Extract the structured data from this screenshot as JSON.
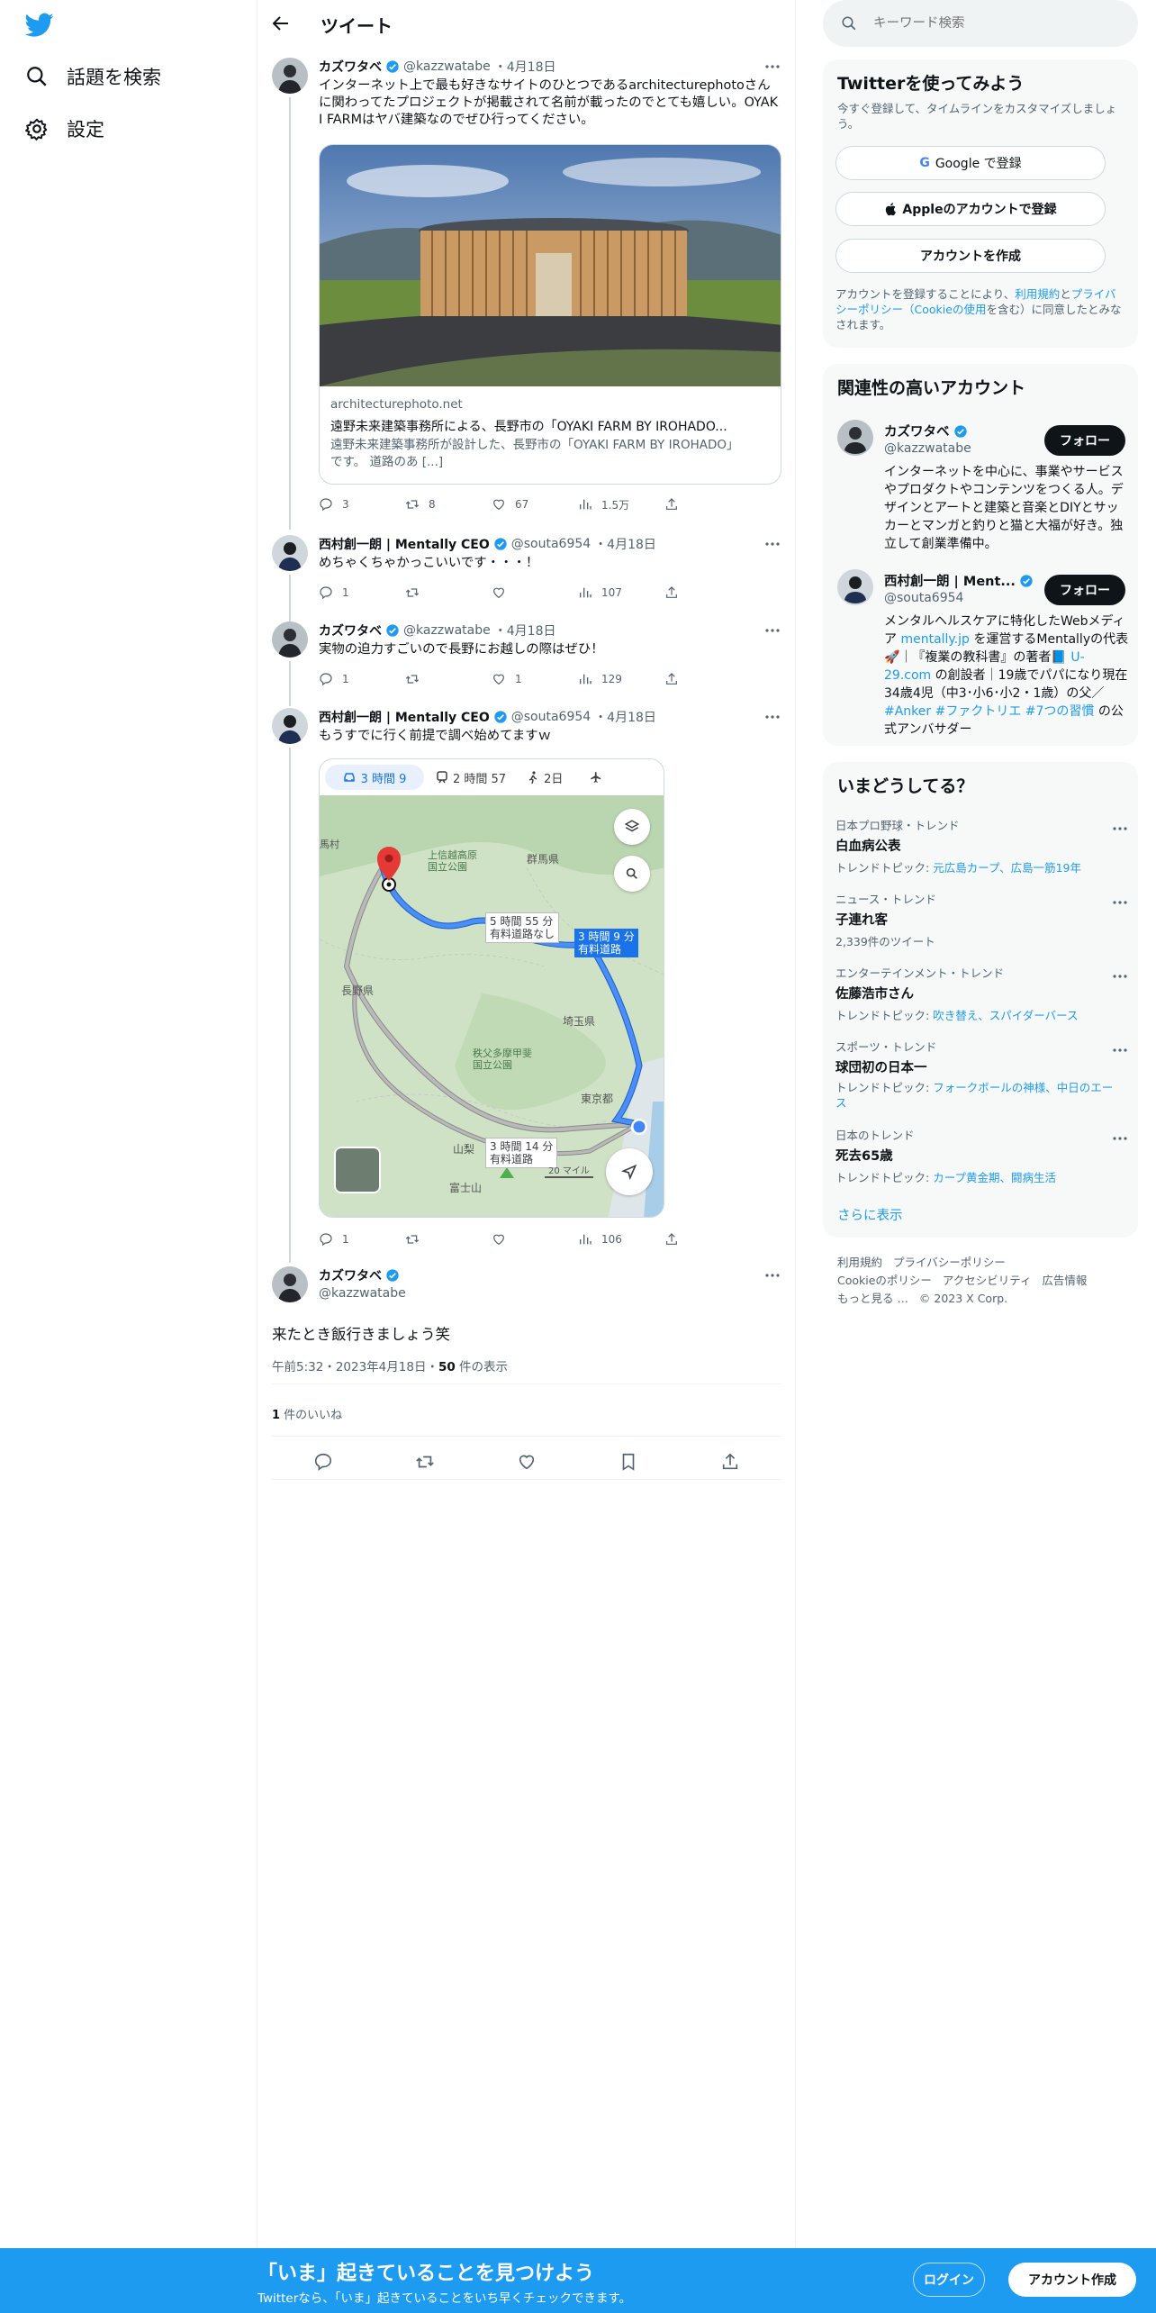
{
  "nav": {
    "items": [
      {
        "label": "話題を検索",
        "icon": "search-icon"
      },
      {
        "label": "設定",
        "icon": "gear-icon"
      }
    ]
  },
  "header": {
    "title": "ツイート"
  },
  "tweets": [
    {
      "name": "カズワタベ",
      "handle": "@kazzwatabe",
      "date": "・4月18日",
      "text": "インターネット上で最も好きなサイトのひとつであるarchitecturephotoさんに関わってたプロジェクトが掲載されて名前が載ったのでとても嬉しい。OYAKI FARMはヤバ建築なのでぜひ行ってください。",
      "card": {
        "domain": "architecturephoto.net",
        "title": "遠野未来建築事務所による、長野市の「OYAKI FARM BY IROHADO...",
        "desc": "遠野未来建築事務所が設計した、長野市の「OYAKI FARM BY IROHADO」です。 道路のあ [...]"
      },
      "stats": {
        "reply": "3",
        "retweet": "8",
        "like": "67",
        "views": "1.5万"
      }
    },
    {
      "name": "西村創一朗 | Mentally CEO",
      "handle": "@souta6954",
      "date": "・4月18日",
      "text": "めちゃくちゃかっこいいです・・・！",
      "stats": {
        "reply": "1",
        "retweet": "",
        "like": "",
        "views": "107"
      }
    },
    {
      "name": "カズワタベ",
      "handle": "@kazzwatabe",
      "date": "・4月18日",
      "text": "実物の迫力すごいので長野にお越しの際はぜひ！",
      "stats": {
        "reply": "1",
        "retweet": "",
        "like": "1",
        "views": "129"
      }
    },
    {
      "name": "西村創一朗 | Mentally CEO",
      "handle": "@souta6954",
      "date": "・4月18日",
      "text": "もうすでに行く前提で調べ始めてますｗ",
      "map": {
        "tabs": [
          "3 時間 9",
          "2 時間 57",
          "2日"
        ],
        "labels": {
          "route1": "5 時間 55 分",
          "route1_sub": "有料道路なし",
          "route2": "3 時間 9 分",
          "route2_sub": "有料道路",
          "route3": "3 時間 14 分",
          "route3_sub": "有料道路",
          "gunma": "群馬県",
          "nagano": "長野県",
          "saitama": "埼玉県",
          "tokyo": "東京都",
          "yamanashi": "山梨",
          "fuji": "富士山",
          "park1": "上信越高原\n国立公園",
          "park2": "秩父多摩甲斐\n国立公園",
          "village": "馬村",
          "scale": "20 マイル"
        }
      },
      "stats": {
        "reply": "1",
        "retweet": "",
        "like": "",
        "views": "106"
      }
    }
  ],
  "main_tweet": {
    "name": "カズワタベ",
    "handle": "@kazzwatabe",
    "text": "来たとき飯行きましょう笑",
    "time": "午前5:32・2023年4月18日・",
    "views_count": "50",
    "views_label": " 件の表示",
    "likes_count": "1",
    "likes_label": " 件のいいね"
  },
  "right": {
    "search_placeholder": "キーワード検索",
    "signup": {
      "title": "Twitterを使ってみよう",
      "subtitle": "今すぐ登録して、タイムラインをカスタマイズしましょう。",
      "google": "Google で登録",
      "apple": "Appleのアカウントで登録",
      "create": "アカウントを作成",
      "legal_pre": "アカウントを登録することにより、",
      "legal_terms": "利用規約",
      "legal_and": "と",
      "legal_privacy": "プライバシーポリシー",
      "legal_cookie": "（Cookieの使用",
      "legal_post": "を含む）に同意したとみなされます。"
    },
    "related": {
      "title": "関連性の高いアカウント",
      "follow_label": "フォロー",
      "accounts": [
        {
          "name": "カズワタベ",
          "handle": "@kazzwatabe",
          "bio": "インターネットを中心に、事業やサービスやプロダクトやコンテンツをつくる人。デザインとアートと建築と音楽とDIYとサッカーとマンガと釣りと猫と大福が好き。独立して創業準備中。"
        },
        {
          "name": "西村創一朗 | Ment...",
          "handle": "@souta6954",
          "bio_a": "メンタルヘルスケアに特化したWebメディア ",
          "bio_link1": "mentally.jp",
          "bio_b": " を運営するMentallyの代表🚀｜『複業の教科書』の著者📘 ",
          "bio_link2": "U-29.com",
          "bio_c": " の創設者｜19歳でパパになり現在34歳4児（中3･小6･小2・1歳）の父／ ",
          "bio_link3": "#Anker #ファクトリエ #7つの習慣",
          "bio_d": " の公式アンバサダー"
        }
      ]
    },
    "trends": {
      "title": "いまどうしてる？",
      "items": [
        {
          "category": "日本プロ野球・トレンド",
          "name": "白血病公表",
          "sub_label": "トレンドトピック: ",
          "sub_links": "元広島カープ、広島一筋19年"
        },
        {
          "category": "ニュース・トレンド",
          "name": "子連れ客",
          "sub_label": "2,339件のツイート",
          "sub_links": ""
        },
        {
          "category": "エンターテインメント・トレンド",
          "name": "佐藤浩市さん",
          "sub_label": "トレンドトピック: ",
          "sub_links": "吹き替え、スパイダーバース"
        },
        {
          "category": "スポーツ・トレンド",
          "name": "球団初の日本一",
          "sub_label": "トレンドトピック: ",
          "sub_links": "フォークボールの神様、中日のエース"
        },
        {
          "category": "日本のトレンド",
          "name": "死去65歳",
          "sub_label": "トレンドトピック: ",
          "sub_links": "カープ黄金期、闘病生活"
        }
      ],
      "show_more": "さらに表示"
    },
    "footer": {
      "terms": "利用規約",
      "privacy": "プライバシーポリシー",
      "cookie": "Cookieのポリシー",
      "accessibility": "アクセシビリティ",
      "ads": "広告情報",
      "more": "もっと見る …",
      "copyright": "© 2023 X Corp."
    }
  },
  "bottom_bar": {
    "title": "「いま」起きていることを見つけよう",
    "subtitle": "Twitterなら、「いま」起きていることをいち早くチェックできます。",
    "login": "ログイン",
    "signup": "アカウント作成"
  },
  "colors": {
    "accent": "#1d9bf0",
    "text": "#0f1419",
    "muted": "#536471",
    "border": "#eff3f4"
  }
}
